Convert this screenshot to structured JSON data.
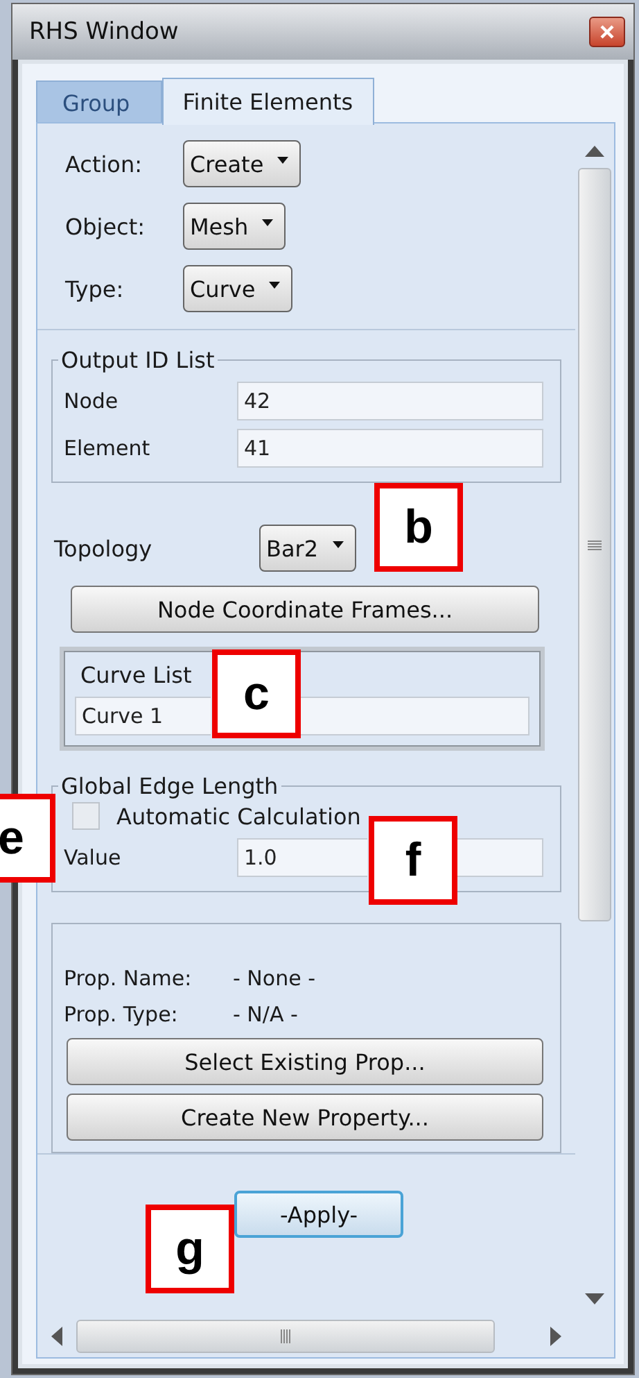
{
  "window": {
    "title": "RHS Window"
  },
  "tabs": [
    {
      "label": "Group",
      "selected": false
    },
    {
      "label": "Finite Elements",
      "selected": true
    }
  ],
  "selectors": [
    {
      "label": "Action:",
      "value": "Create"
    },
    {
      "label": "Object:",
      "value": "Mesh"
    },
    {
      "label": "Type:",
      "value": "Curve"
    }
  ],
  "output_id_list": {
    "title": "Output ID List",
    "fields": [
      {
        "label": "Node",
        "value": "42"
      },
      {
        "label": "Element",
        "value": "41"
      }
    ]
  },
  "topology": {
    "label": "Topology",
    "value": "Bar2"
  },
  "node_coordinate_button": "Node Coordinate Frames...",
  "curve_list": {
    "title": "Curve List",
    "value": "Curve 1"
  },
  "global_edge_length": {
    "title": "Global Edge Length",
    "automatic": {
      "label": "Automatic Calculation",
      "checked": false
    },
    "value_label": "Value",
    "value": "1.0"
  },
  "property": {
    "rows": [
      {
        "label": "Prop. Name:",
        "value": "- None -"
      },
      {
        "label": "Prop. Type:",
        "value": "- N/A -"
      }
    ],
    "buttons": [
      "Select Existing Prop...",
      "Create New Property..."
    ]
  },
  "apply_button": "-Apply-",
  "callouts": [
    {
      "label": "b"
    },
    {
      "label": "c"
    },
    {
      "label": "e"
    },
    {
      "label": "f"
    },
    {
      "label": "g"
    }
  ]
}
